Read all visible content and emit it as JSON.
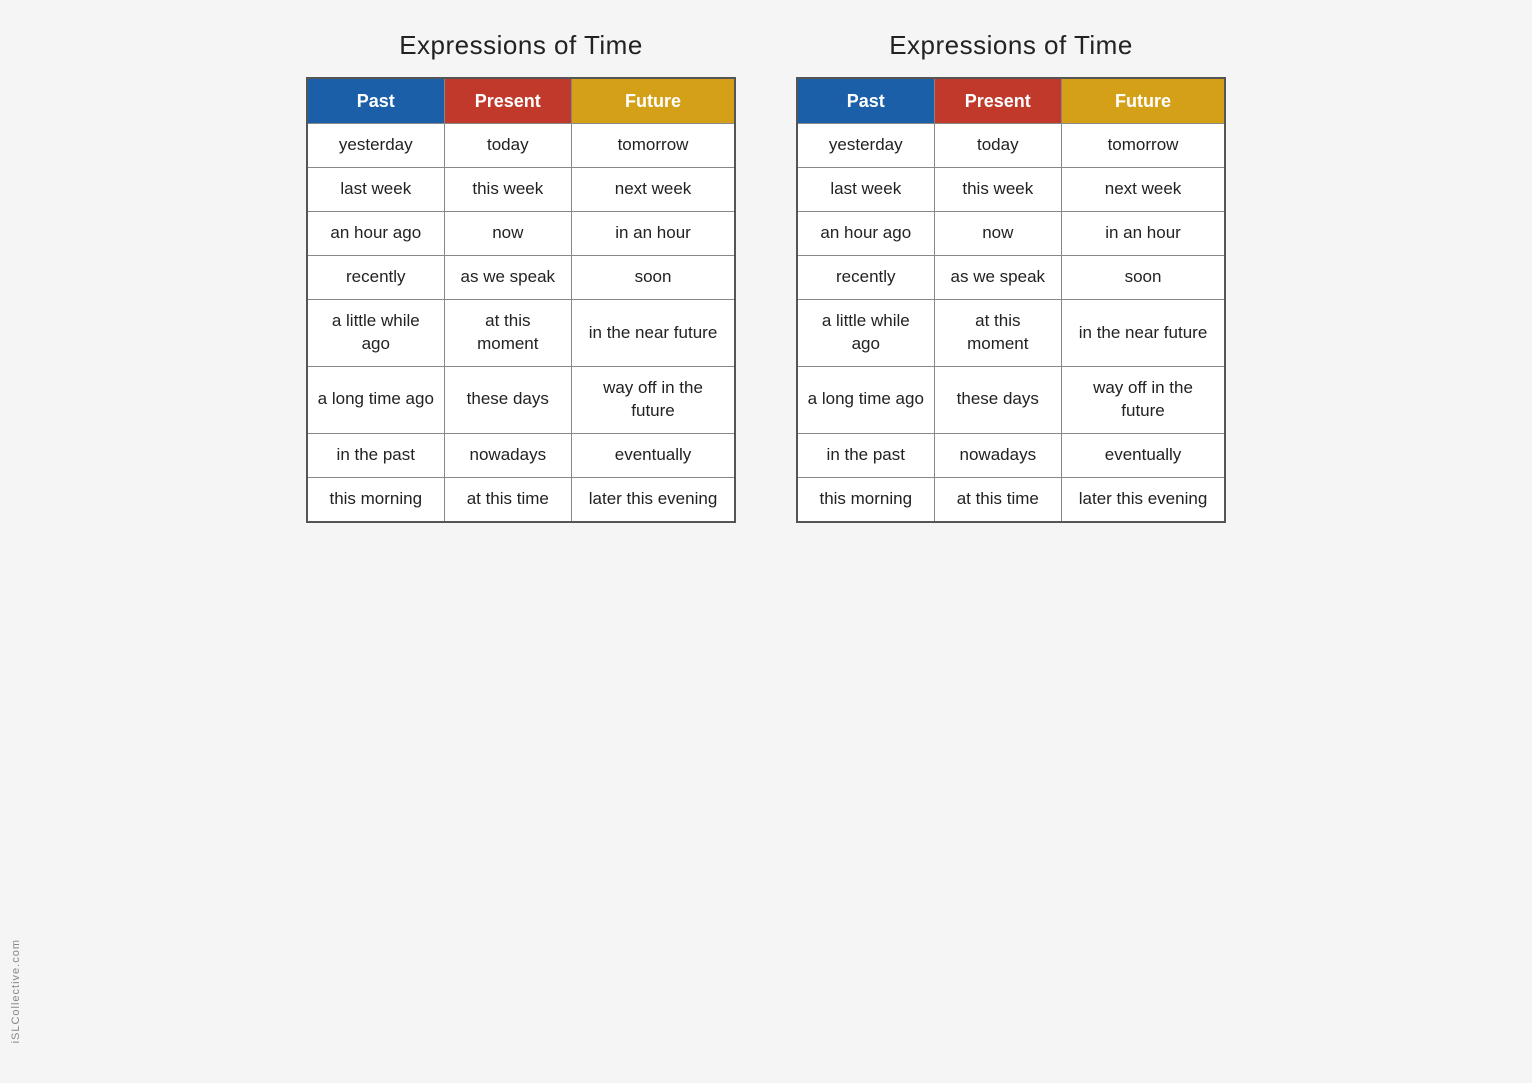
{
  "title": "Expressions of Time",
  "watermark": "iSLCollective.com",
  "headers": {
    "past": "Past",
    "present": "Present",
    "future": "Future"
  },
  "rows": [
    {
      "past": "yesterday",
      "present": "today",
      "future": "tomorrow"
    },
    {
      "past": "last week",
      "present": "this week",
      "future": "next week"
    },
    {
      "past": "an hour ago",
      "present": "now",
      "future": "in an hour"
    },
    {
      "past": "recently",
      "present": "as we speak",
      "future": "soon"
    },
    {
      "past": "a little while ago",
      "present": "at this moment",
      "future": "in the near future"
    },
    {
      "past": "a long time ago",
      "present": "these days",
      "future": "way off in the future"
    },
    {
      "past": "in the past",
      "present": "nowadays",
      "future": "eventually"
    },
    {
      "past": "this morning",
      "present": "at this time",
      "future": "later this evening"
    }
  ]
}
